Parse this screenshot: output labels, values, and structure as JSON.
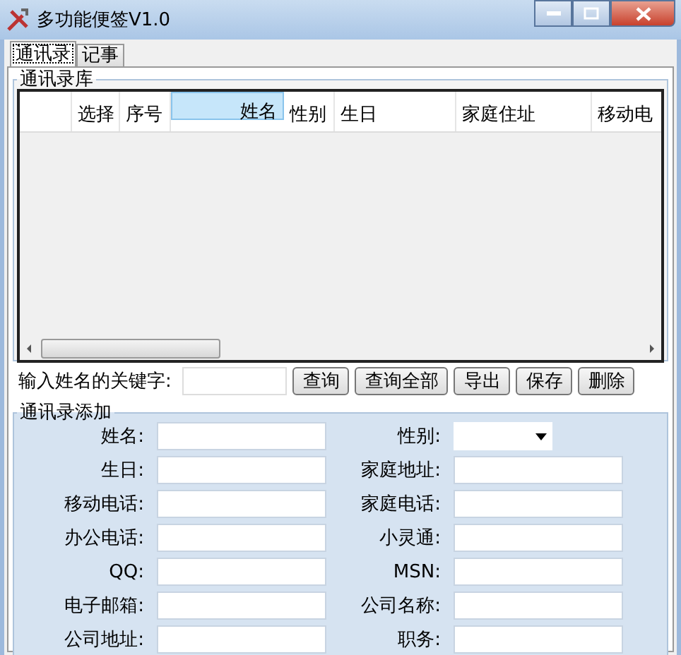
{
  "window": {
    "title": "多功能便签V1.0"
  },
  "tabs": [
    {
      "label": "通讯录",
      "selected": true
    },
    {
      "label": "记事",
      "selected": false
    }
  ],
  "contacts_group": {
    "title": "通讯录库",
    "columns": [
      {
        "label": "选择",
        "selected": false
      },
      {
        "label": "序号",
        "selected": false
      },
      {
        "label": "姓名",
        "selected": true
      },
      {
        "label": "性别",
        "selected": false
      },
      {
        "label": "生日",
        "selected": false
      },
      {
        "label": "家庭住址",
        "selected": false
      },
      {
        "label": "移动电",
        "selected": false
      }
    ]
  },
  "search": {
    "label": "输入姓名的关键字:",
    "buttons": [
      "查询",
      "查询全部",
      "导出",
      "保存",
      "删除"
    ]
  },
  "add_group": {
    "title": "通讯录添加",
    "fields": [
      {
        "label": "姓名:",
        "kind": "text"
      },
      {
        "label": "性别:",
        "kind": "select"
      },
      {
        "label": "生日:",
        "kind": "text"
      },
      {
        "label": "家庭地址:",
        "kind": "text"
      },
      {
        "label": "移动电话:",
        "kind": "text"
      },
      {
        "label": "家庭电话:",
        "kind": "text"
      },
      {
        "label": "办公电话:",
        "kind": "text"
      },
      {
        "label": "小灵通:",
        "kind": "text"
      },
      {
        "label": "QQ:",
        "kind": "text"
      },
      {
        "label": "MSN:",
        "kind": "text"
      },
      {
        "label": "电子邮箱:",
        "kind": "text"
      },
      {
        "label": "公司名称:",
        "kind": "text"
      },
      {
        "label": "公司地址:",
        "kind": "text"
      },
      {
        "label": "职务:",
        "kind": "text"
      }
    ]
  }
}
